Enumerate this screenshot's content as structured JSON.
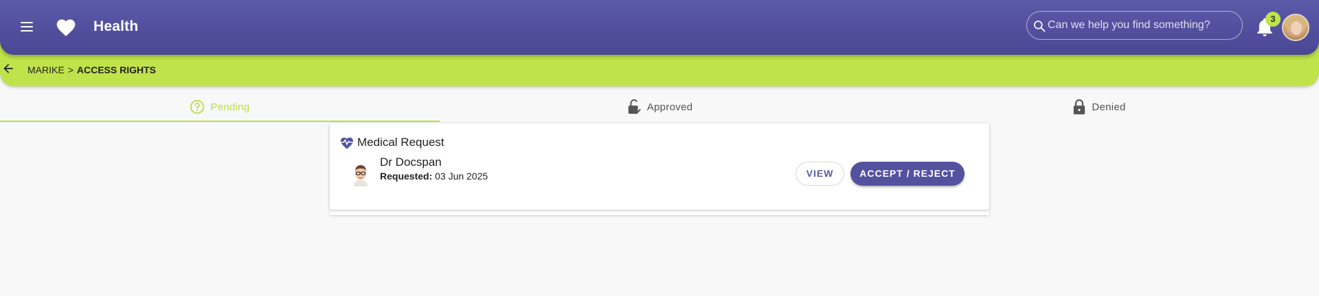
{
  "header": {
    "title": "Health",
    "search_placeholder": "Can we help you find something?",
    "notification_count": "3",
    "icons": {
      "menu": "menu-icon",
      "logo": "heart-icon",
      "search": "search-icon",
      "notifications": "bell-icon",
      "avatar": "user-avatar"
    },
    "colors": {
      "primary": "#5b5aa8",
      "accent": "#bfe34a"
    }
  },
  "breadcrumb": {
    "items": [
      "MARIKE",
      "ACCESS RIGHTS"
    ],
    "separator": ">"
  },
  "tabs": [
    {
      "label": "Pending",
      "icon": "help-circle-icon",
      "active": true
    },
    {
      "label": "Approved",
      "icon": "lock-open-check-icon",
      "active": false
    },
    {
      "label": "Denied",
      "icon": "lock-icon",
      "active": false
    }
  ],
  "request_card": {
    "title": "Medical Request",
    "title_icon": "heart-pulse-icon",
    "doctor_name": "Dr Docspan",
    "requested_label": "Requested:",
    "requested_date": "03 Jun 2025",
    "view_button": "VIEW",
    "accept_button": "ACCEPT / REJECT"
  }
}
